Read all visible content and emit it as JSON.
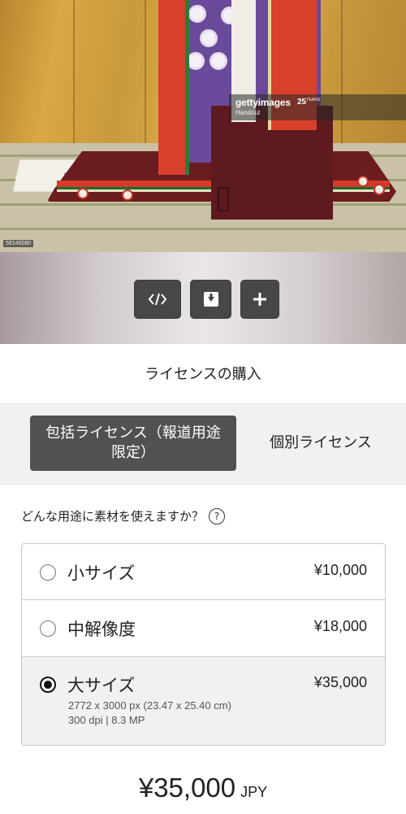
{
  "photo": {
    "watermark_brand": "gettyimages",
    "watermark_credit": "Handout",
    "watermark_badge": "25",
    "watermark_badge_sub": "YEARS",
    "paper_marks": "一月の",
    "image_id": "56146080"
  },
  "actions": {
    "embed_icon": "code-embed-icon",
    "download_icon": "download-icon",
    "add_icon": "plus-icon"
  },
  "panel": {
    "title": "ライセンスの購入"
  },
  "tabs": [
    {
      "label": "包括ライセンス（報道用途限定）",
      "active": true
    },
    {
      "label": "個別ライセンス",
      "active": false
    }
  ],
  "question": {
    "text": "どんな用途に素材を使えますか？",
    "help_icon": "?"
  },
  "options": [
    {
      "label": "小サイズ",
      "price": "¥10,000",
      "selected": false
    },
    {
      "label": "中解像度",
      "price": "¥18,000",
      "selected": false
    },
    {
      "label": "大サイズ",
      "price": "¥35,000",
      "selected": true,
      "detail_line1": "2772 x 3000 px (23.47 x 25.40 cm)",
      "detail_line2": "300 dpi | 8.3 MP"
    }
  ],
  "total": {
    "amount": "¥35,000",
    "currency": "JPY"
  },
  "colors": {
    "active_tab": "#515151",
    "action_button": "#474747",
    "tab_bar_bg": "#f1f1f1"
  }
}
